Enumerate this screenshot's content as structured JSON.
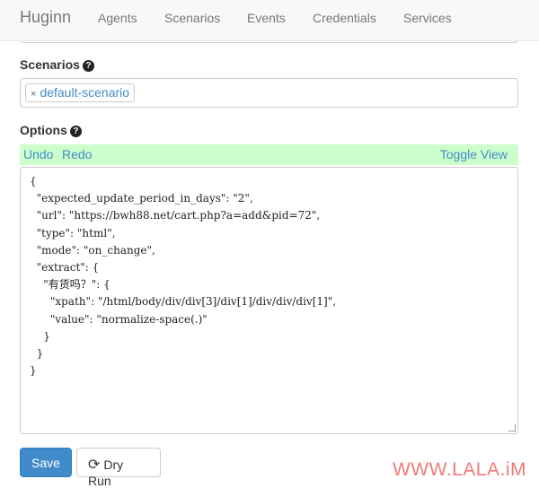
{
  "nav": {
    "brand": "Huginn",
    "items": [
      "Agents",
      "Scenarios",
      "Events",
      "Credentials",
      "Services"
    ]
  },
  "scenarios": {
    "label": "Scenarios",
    "help_icon": "?",
    "tag": "default-scenario",
    "tag_remove": "×"
  },
  "options": {
    "label": "Options",
    "help_icon": "?",
    "undo": "Undo",
    "redo": "Redo",
    "toggle": "Toggle View",
    "json": "{\n  \"expected_update_period_in_days\": \"2\",\n  \"url\": \"https://bwh88.net/cart.php?a=add&pid=72\",\n  \"type\": \"html\",\n  \"mode\": \"on_change\",\n  \"extract\": {\n    \"有货吗？\": {\n      \"xpath\": \"/html/body/div/div[3]/div[1]/div/div/div[1]\",\n      \"value\": \"normalize-space(.)\"\n    }\n  }\n}"
  },
  "buttons": {
    "save": "Save",
    "dry_run": "Dry Run"
  },
  "watermark": "WWW.LALA.iM"
}
